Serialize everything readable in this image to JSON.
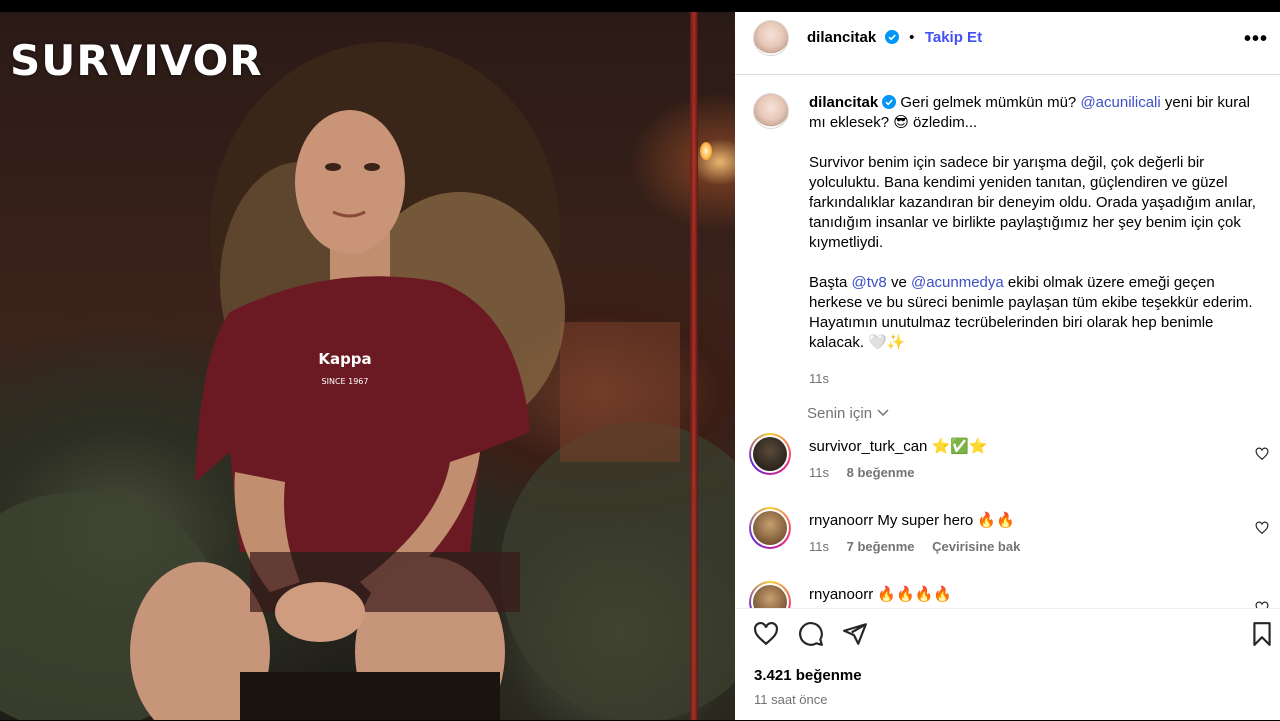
{
  "photo": {
    "logo_text": "SURVIVOR",
    "shirt_text": "Kappa",
    "shirt_sub": "SINCE 1967"
  },
  "post": {
    "username": "dilancitak",
    "follow_label": "Takip Et",
    "more_label": "•••",
    "caption": {
      "p1_text": "Geri gelmek mümkün mü?",
      "p1_mention": "@acunilicali",
      "p1_rest": "yeni bir kural mı eklesek? 😎 özledim...",
      "p2": "Survivor benim için sadece bir yarışma değil, çok değerli bir yolculuktu. Bana kendimi yeniden tanıtan, güçlendiren ve güzel farkındalıklar kazandıran bir deneyim oldu. Orada yaşadığım anılar, tanıdığım insanlar ve birlikte paylaştığımız her şey benim için çok kıymetliydi.",
      "p3_a": "Başta",
      "p3_m1": "@tv8",
      "p3_b": "ve",
      "p3_m2": "@acunmedya",
      "p3_c": "ekibi olmak üzere emeği geçen herkese ve bu süreci benimle paylaşan tüm ekibe teşekkür ederim. Hayatımın unutulmaz tecrübelerinden biri olarak hep benimle kalacak. 🤍✨",
      "time": "11s"
    },
    "sort_label": "Senin için",
    "comments": [
      {
        "user": "survivor_turk_can",
        "text": "⭐✅⭐",
        "time": "11s",
        "likes": "8 beğenme",
        "translate": ""
      },
      {
        "user": "rnyanoorr",
        "text": "My super hero 🔥🔥",
        "time": "11s",
        "likes": "7 beğenme",
        "translate": "Çevirisine bak"
      },
      {
        "user": "rnyanoorr",
        "text": "🔥🔥🔥🔥",
        "time": "",
        "likes": "",
        "translate": ""
      }
    ],
    "like_count": "3.421 beğenme",
    "posted": "11 saat önce"
  }
}
